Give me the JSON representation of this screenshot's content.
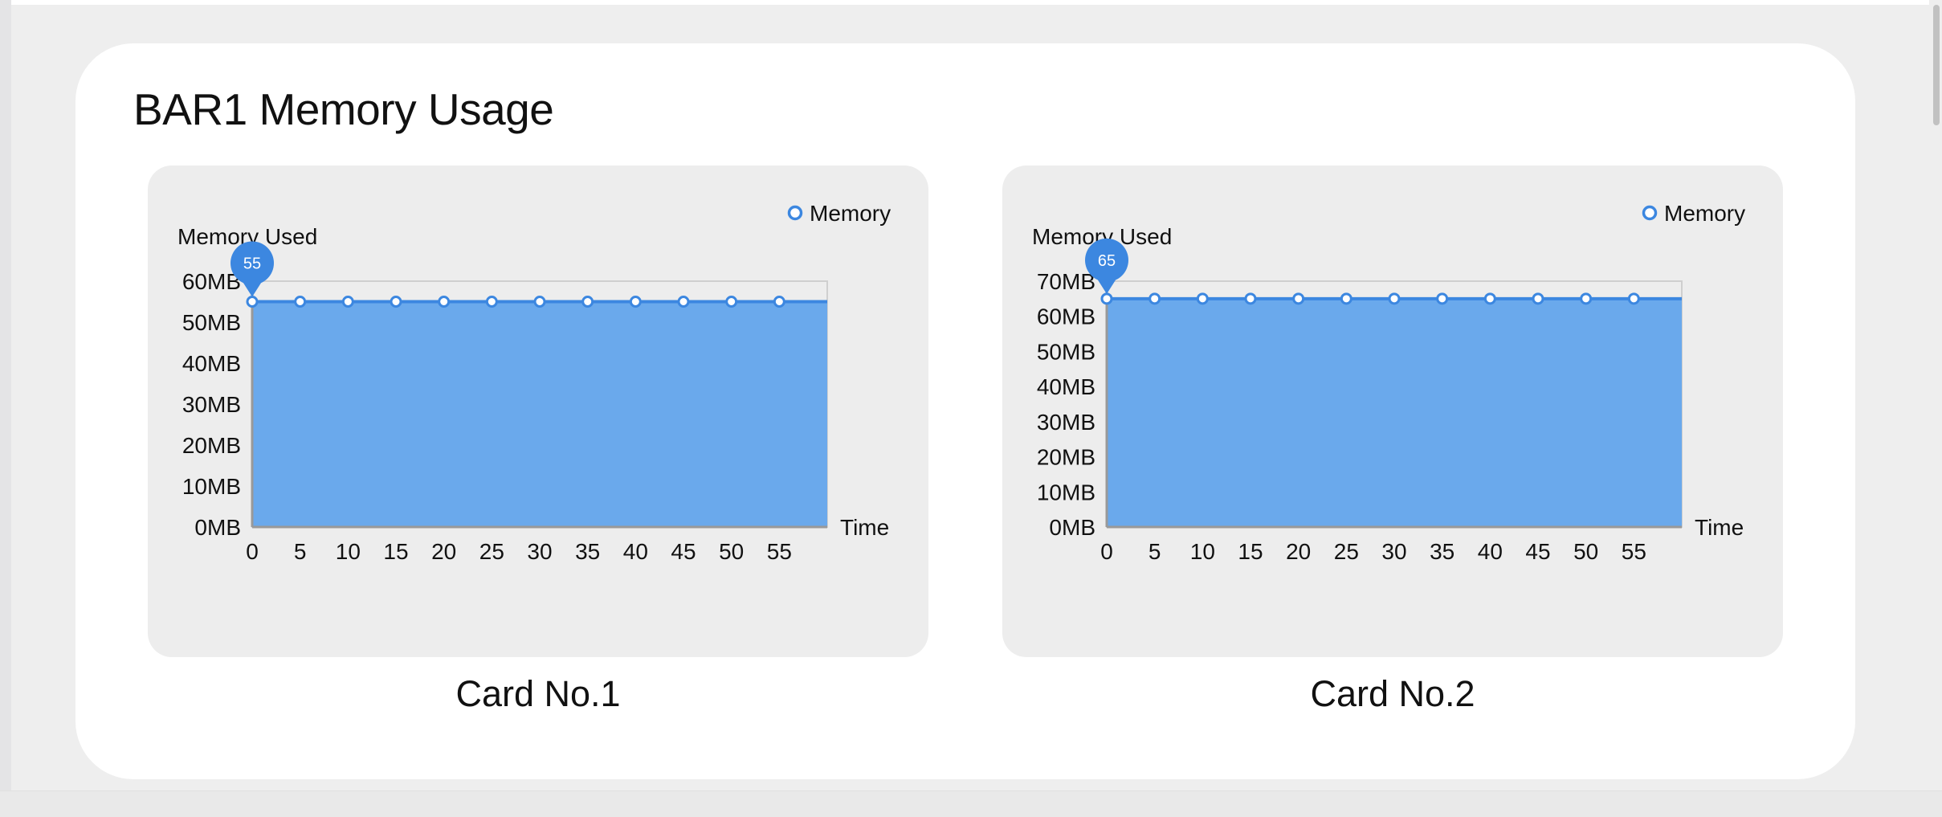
{
  "page": {
    "title": "BAR1 Memory Usage"
  },
  "colors": {
    "area_fill": "#6aa9ec",
    "line": "#3c87e0",
    "marker_fill": "#ffffff",
    "bubble": "#3c87e0",
    "axis": "#999999",
    "text": "#111111"
  },
  "cards": [
    {
      "caption": "Card No.1"
    },
    {
      "caption": "Card No.2"
    }
  ],
  "chart_data": [
    {
      "type": "area",
      "ylabel": "Memory Used",
      "xlabel": "Time",
      "legend": {
        "label": "Memory",
        "position": "top-right"
      },
      "y_unit": "MB",
      "ylim": [
        0,
        60
      ],
      "y_ticks": [
        0,
        10,
        20,
        30,
        40,
        50,
        60
      ],
      "xlim": [
        0,
        60
      ],
      "x_ticks": [
        0,
        5,
        10,
        15,
        20,
        25,
        30,
        35,
        40,
        45,
        50,
        55
      ],
      "series": [
        {
          "name": "Memory",
          "x": [
            0,
            5,
            10,
            15,
            20,
            25,
            30,
            35,
            40,
            45,
            50,
            55
          ],
          "values": [
            55,
            55,
            55,
            55,
            55,
            55,
            55,
            55,
            55,
            55,
            55,
            55
          ]
        }
      ],
      "highlight": {
        "x": 0,
        "label": "55"
      }
    },
    {
      "type": "area",
      "ylabel": "Memory Used",
      "xlabel": "Time",
      "legend": {
        "label": "Memory",
        "position": "top-right"
      },
      "y_unit": "MB",
      "ylim": [
        0,
        70
      ],
      "y_ticks": [
        0,
        10,
        20,
        30,
        40,
        50,
        60,
        70
      ],
      "xlim": [
        0,
        60
      ],
      "x_ticks": [
        0,
        5,
        10,
        15,
        20,
        25,
        30,
        35,
        40,
        45,
        50,
        55
      ],
      "series": [
        {
          "name": "Memory",
          "x": [
            0,
            5,
            10,
            15,
            20,
            25,
            30,
            35,
            40,
            45,
            50,
            55
          ],
          "values": [
            65,
            65,
            65,
            65,
            65,
            65,
            65,
            65,
            65,
            65,
            65,
            65
          ]
        }
      ],
      "highlight": {
        "x": 0,
        "label": "65"
      }
    }
  ]
}
